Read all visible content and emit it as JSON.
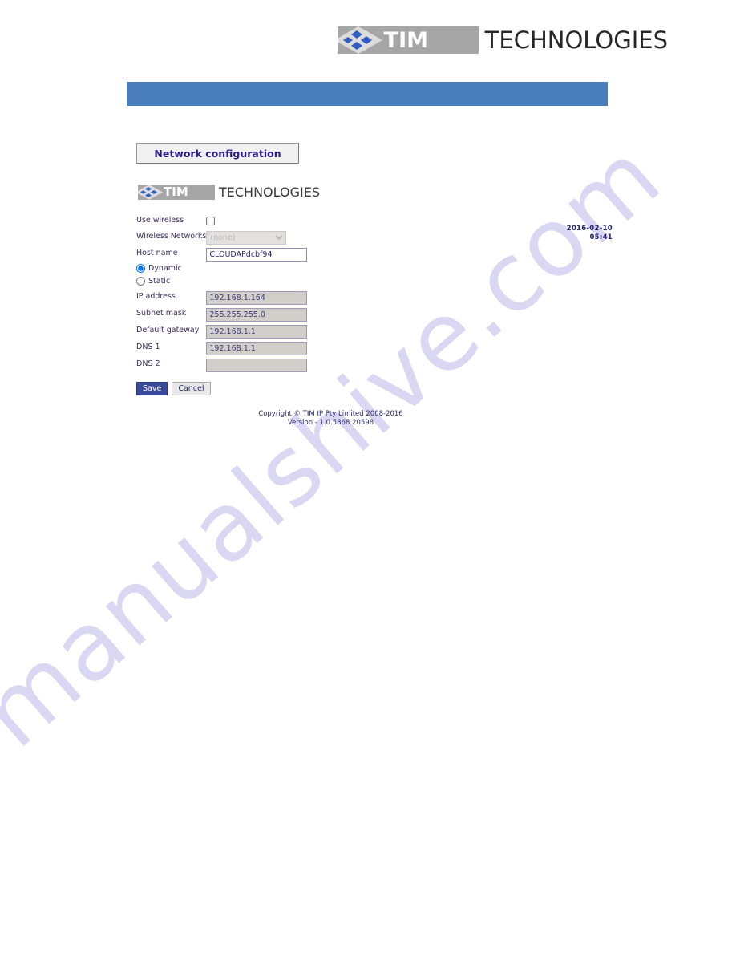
{
  "page_header": {
    "logo": {
      "mark_text": "TIM",
      "word_text": "TECHNOLOGIES",
      "mark_bg_color": "#a6a6a6",
      "diamond_color": "#2f5fc0"
    }
  },
  "blue_band": {
    "color": "#4a7ebb"
  },
  "device_ui": {
    "tab": {
      "label": "Network configuration"
    },
    "logo": {
      "mark_text": "TIM",
      "word_text": "TECHNOLOGIES"
    },
    "datetime": {
      "date": "2016-02-10",
      "time": "05:41"
    },
    "form": {
      "rows": [
        {
          "label": "Use wireless",
          "type": "checkbox",
          "checked": false
        },
        {
          "label": "Wireless Networks",
          "type": "select",
          "value": "(none)",
          "options": [
            "(none)"
          ],
          "disabled": true
        },
        {
          "label": "Host name",
          "type": "text",
          "value": "CLOUDAPdcbf94",
          "disabled": false
        },
        {
          "label": "IP address",
          "type": "text",
          "value": "192.168.1.164",
          "disabled": true
        },
        {
          "label": "Subnet mask",
          "type": "text",
          "value": "255.255.255.0",
          "disabled": true
        },
        {
          "label": "Default gateway",
          "type": "text",
          "value": "192.168.1.1",
          "disabled": true
        },
        {
          "label": "DNS 1",
          "type": "text",
          "value": "192.168.1.1",
          "disabled": true
        },
        {
          "label": "DNS 2",
          "type": "text",
          "value": "",
          "disabled": true
        }
      ],
      "address_mode": {
        "dynamic_label": "Dynamic",
        "static_label": "Static",
        "selected": "Dynamic"
      }
    },
    "buttons": {
      "save_label": "Save",
      "cancel_label": "Cancel"
    },
    "footer": {
      "copyright": "Copyright © TIM IP Pty Limited 2008-2016",
      "version": "Version - 1.0.5868.20598"
    }
  },
  "watermark": {
    "text": "manualshive.com",
    "color": "#cdc9ef"
  }
}
